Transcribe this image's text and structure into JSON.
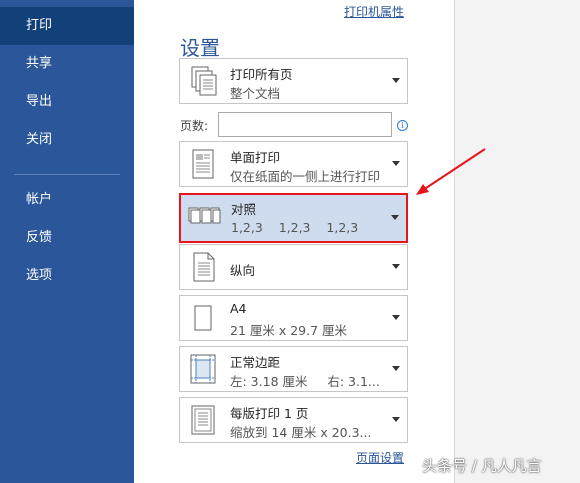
{
  "sidebar": {
    "items": [
      {
        "label": "打印",
        "active": true
      },
      {
        "label": "共享"
      },
      {
        "label": "导出"
      },
      {
        "label": "关闭"
      },
      {
        "label": "帐户"
      },
      {
        "label": "反馈"
      },
      {
        "label": "选项"
      }
    ]
  },
  "printer_properties_link": "打印机属性",
  "settings": {
    "title": "设置",
    "print_range": {
      "title": "打印所有页",
      "subtitle": "整个文档",
      "icon": "pages-stack-icon"
    },
    "pages": {
      "label": "页数:",
      "value": "",
      "info_icon": "i"
    },
    "sides": {
      "title": "单面打印",
      "subtitle": "仅在纸面的一侧上进行打印",
      "icon": "one-sided-icon"
    },
    "collation": {
      "title": "对照",
      "subtitle": "1,2,3    1,2,3    1,2,3",
      "icon": "collated-icon"
    },
    "orientation": {
      "title": "纵向",
      "icon": "portrait-icon"
    },
    "paper": {
      "title": "A4",
      "subtitle": "21 厘米 x 29.7 厘米",
      "icon": "paper-size-icon"
    },
    "margins": {
      "title": "正常边距",
      "subtitle": "左: 3.18 厘米     右: 3.1...",
      "icon": "margins-icon"
    },
    "per_sheet": {
      "title": "每版打印 1 页",
      "subtitle": "缩放到 14 厘米 x 20.3...",
      "icon": "pages-per-sheet-icon"
    }
  },
  "page_setup_link": "页面设置",
  "watermark": "头条号 / 凡人凡言",
  "colors": {
    "sidebar": "#2b579a",
    "sidebar_active": "#124078",
    "highlight_border": "#e8141c",
    "highlight_fill": "#cfdcef"
  }
}
